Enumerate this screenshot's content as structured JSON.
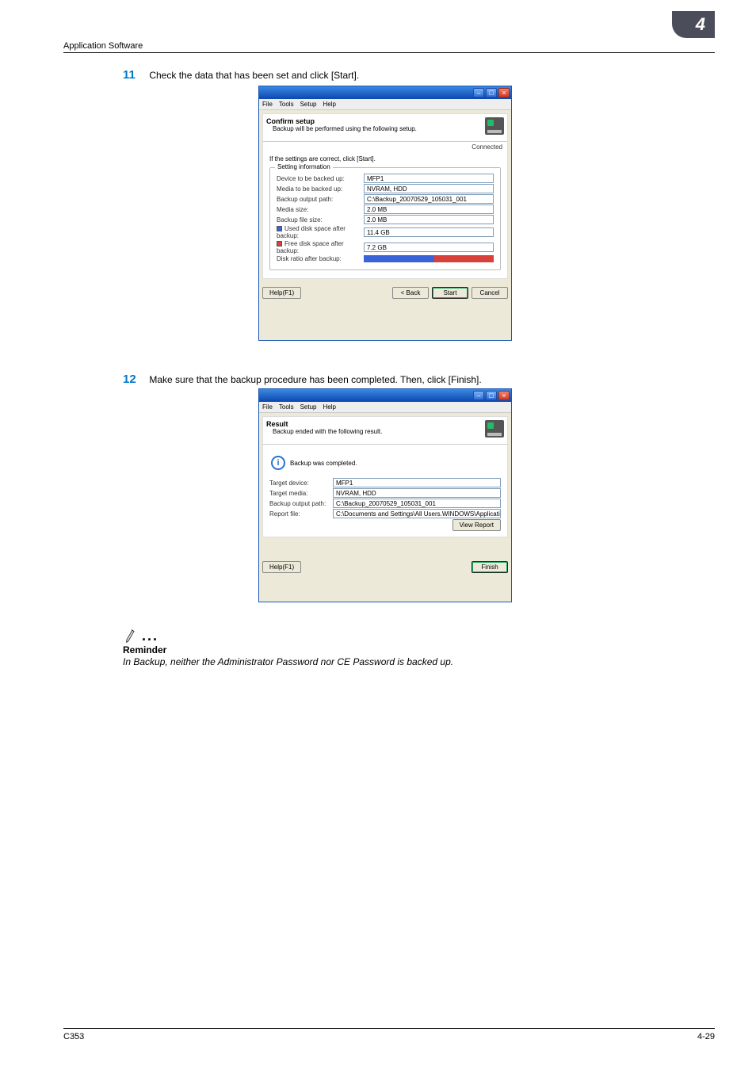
{
  "header": {
    "section": "Application Software",
    "chapter_num": "4"
  },
  "footer": {
    "left": "C353",
    "right": "4-29"
  },
  "step11": {
    "num": "11",
    "text": "Check the data that has been set and click [Start]."
  },
  "step12": {
    "num": "12",
    "text": "Make sure that the backup procedure has been completed. Then, click [Finish]."
  },
  "menu": {
    "file": "File",
    "tools": "Tools",
    "setup": "Setup",
    "help": "Help"
  },
  "dlg1": {
    "title": "Confirm setup",
    "subtitle": "Backup will be performed using the following setup.",
    "connected": "Connected",
    "instruction": "If the settings are correct, click [Start].",
    "legend": "Setting information",
    "rows": {
      "device_lab": "Device to be backed up:",
      "device_val": "MFP1",
      "media_lab": "Media to be backed up:",
      "media_val": "NVRAM, HDD",
      "path_lab": "Backup output path:",
      "path_val": "C:\\Backup_20070529_105031_001",
      "msize_lab": "Media size:",
      "msize_val": "2.0 MB",
      "fsize_lab": "Backup file size:",
      "fsize_val": "2.0 MB",
      "used_lab": "Used disk space after backup:",
      "used_val": "11.4 GB",
      "free_lab": "Free disk space after backup:",
      "free_val": "7.2 GB",
      "ratio_lab": "Disk ratio after backup:"
    },
    "buttons": {
      "help": "Help(F1)",
      "back": "< Back",
      "start": "Start",
      "cancel": "Cancel"
    }
  },
  "dlg2": {
    "title": "Result",
    "subtitle": "Backup ended with the following result.",
    "completed": "Backup was completed.",
    "rows": {
      "device_lab": "Target device:",
      "device_val": "MFP1",
      "media_lab": "Target media:",
      "media_val": "NVRAM, HDD",
      "path_lab": "Backup output path:",
      "path_val": "C:\\Backup_20070529_105031_001",
      "report_lab": "Report file:",
      "report_val": "C:\\Documents and Settings\\All Users.WINDOWS\\Application Data"
    },
    "buttons": {
      "help": "Help(F1)",
      "view": "View Report",
      "finish": "Finish"
    }
  },
  "note": {
    "label": "Reminder",
    "text": "In Backup, neither the Administrator Password nor CE Password is backed up."
  }
}
